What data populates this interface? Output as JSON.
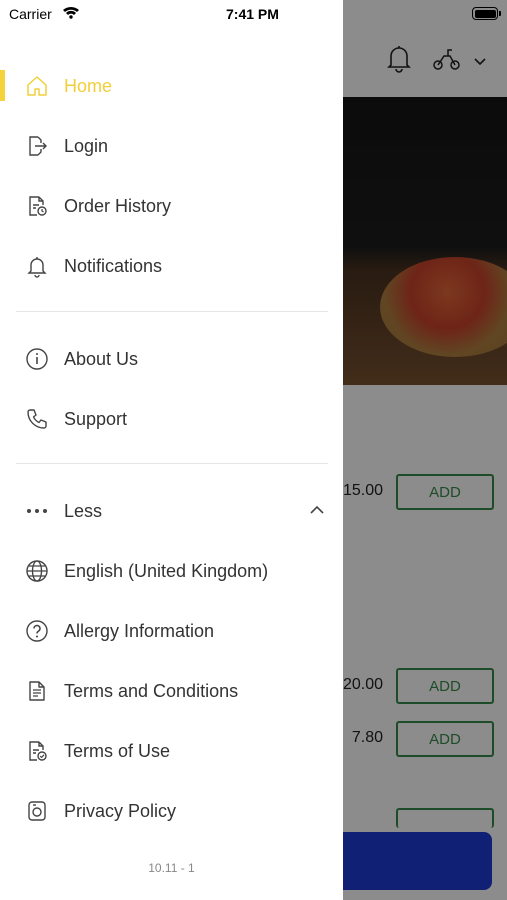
{
  "status_bar": {
    "carrier": "Carrier",
    "time": "7:41 PM"
  },
  "drawer": {
    "items": [
      {
        "label": "Home",
        "icon": "home-icon",
        "active": true
      },
      {
        "label": "Login",
        "icon": "login-icon"
      },
      {
        "label": "Order History",
        "icon": "order-history-icon"
      },
      {
        "label": "Notifications",
        "icon": "bell-icon"
      },
      {
        "label": "About Us",
        "icon": "info-icon"
      },
      {
        "label": "Support",
        "icon": "phone-icon"
      },
      {
        "label": "Less",
        "icon": "more-dots-icon"
      },
      {
        "label": "English (United Kingdom)",
        "icon": "globe-icon"
      },
      {
        "label": "Allergy Information",
        "icon": "question-icon"
      },
      {
        "label": "Terms and Conditions",
        "icon": "document-icon"
      },
      {
        "label": "Terms of Use",
        "icon": "document-check-icon"
      },
      {
        "label": "Privacy Policy",
        "icon": "privacy-icon"
      }
    ],
    "version": "10.11 - 1"
  },
  "background": {
    "prices": [
      "15.00",
      "20.00",
      "7.80"
    ],
    "add_label": "ADD"
  },
  "colors": {
    "accent": "#f0cf3a",
    "add_button": "#3a8a4a",
    "bottom_button": "#1d3bd6"
  }
}
